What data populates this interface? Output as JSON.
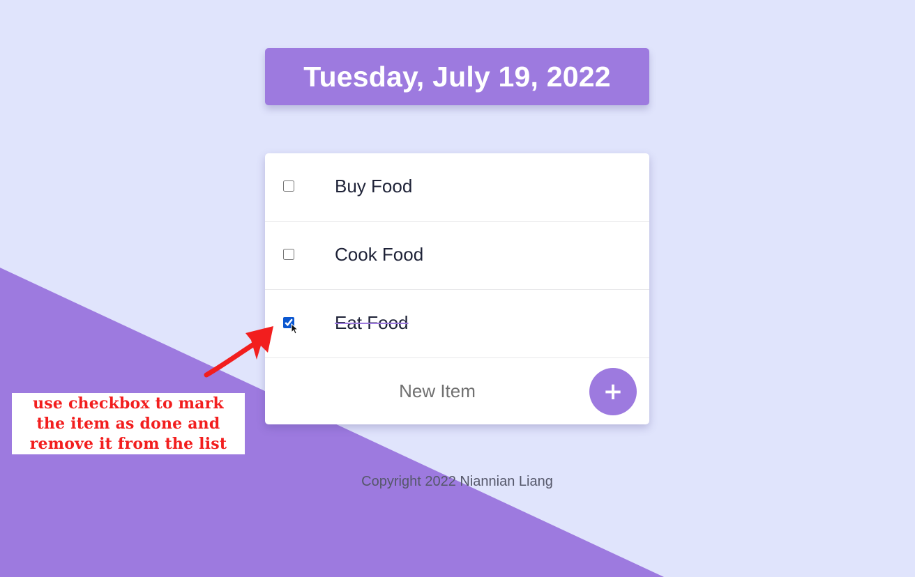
{
  "colors": {
    "background": "#E0E4FC",
    "accent": "#9D7ADF",
    "checkbox_checked": "#0B57D0",
    "annotation_text": "#F21E1E"
  },
  "header": {
    "date_title": "Tuesday, July 19, 2022"
  },
  "todo": {
    "items": [
      {
        "label": "Buy Food",
        "checked": false
      },
      {
        "label": "Cook Food",
        "checked": false
      },
      {
        "label": "Eat Food",
        "checked": true
      }
    ],
    "new_item_placeholder": "New Item",
    "add_button_label": "+"
  },
  "footer": {
    "copyright": "Copyright 2022 Niannian Liang"
  },
  "annotation": {
    "line1": "use checkbox to mark",
    "line2": "the item as done and",
    "line3": "remove it from the list"
  },
  "icons": {
    "cursor": "mouse-pointer-icon",
    "arrow": "red-arrow-icon"
  }
}
